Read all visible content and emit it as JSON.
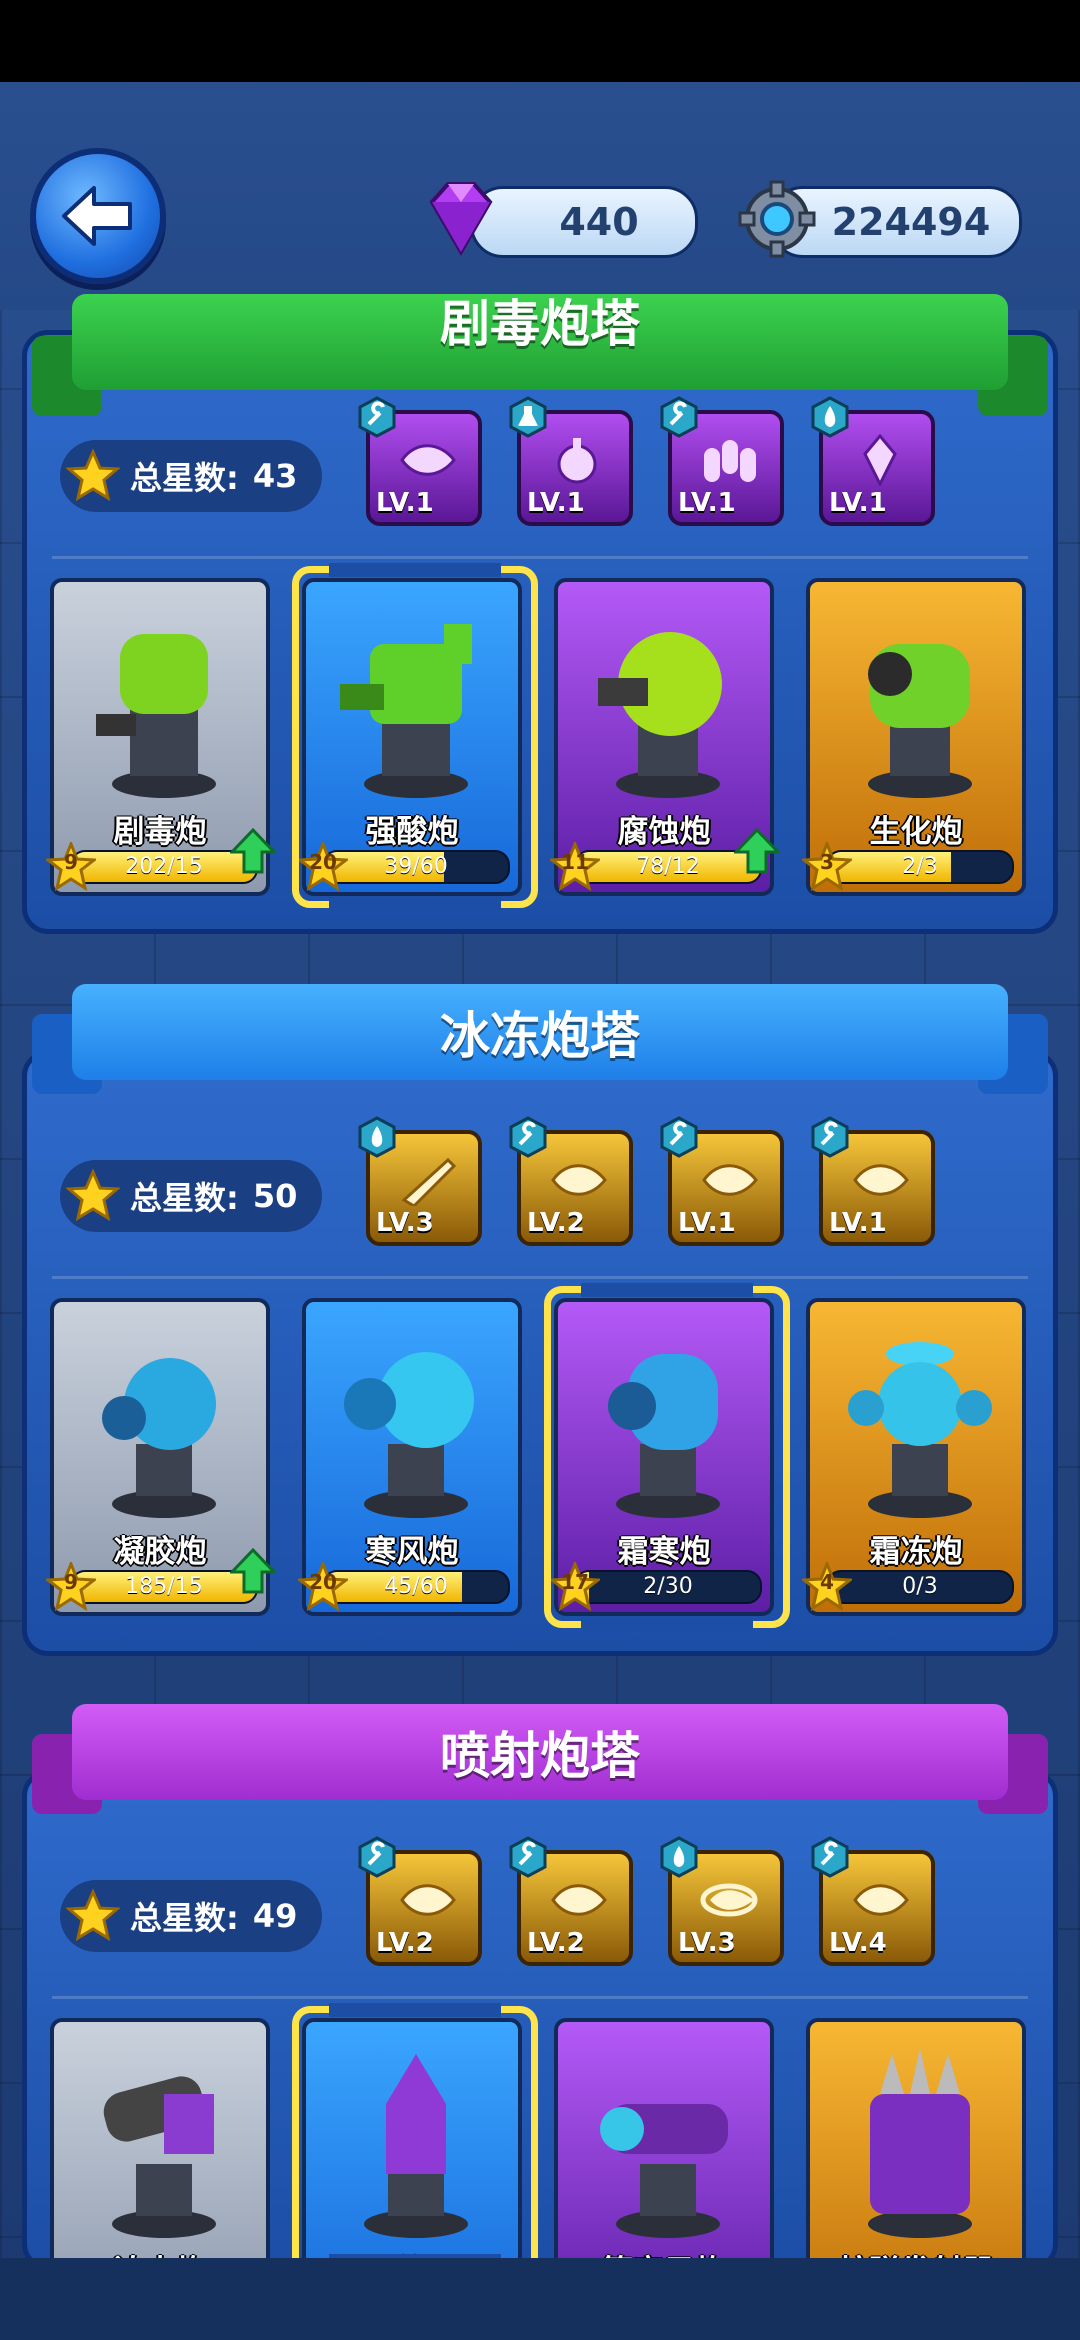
{
  "header": {
    "back_icon": "back-arrow-icon",
    "gems": {
      "icon": "gem-icon",
      "value": "440"
    },
    "gears": {
      "icon": "gear-icon",
      "value": "224494"
    }
  },
  "sections": [
    {
      "title": "剧毒炮塔",
      "color": "#2bb540",
      "star_label": "总星数:",
      "star_total": "43",
      "skills": [
        {
          "level": "LV.1",
          "style": "purple",
          "icon": "bullet-icon",
          "tag_icon": "wrench-icon"
        },
        {
          "level": "LV.1",
          "style": "purple",
          "icon": "bomb-icon",
          "tag_icon": "flask-icon"
        },
        {
          "level": "LV.1",
          "style": "purple",
          "icon": "shells-icon",
          "tag_icon": "wrench-icon"
        },
        {
          "level": "LV.1",
          "style": "purple",
          "icon": "crystal-icon",
          "tag_icon": "drop-icon"
        }
      ],
      "towers": [
        {
          "name": "剧毒炮",
          "stars": "9",
          "progress": "202/15",
          "fill": 1.0,
          "style": "gray",
          "upgrade": true
        },
        {
          "name": "强酸炮",
          "stars": "20",
          "progress": "39/60",
          "fill": 0.65,
          "style": "blue",
          "upgrade": false,
          "selected": true
        },
        {
          "name": "腐蚀炮",
          "stars": "11",
          "progress": "78/12",
          "fill": 1.0,
          "style": "purple",
          "upgrade": true
        },
        {
          "name": "生化炮",
          "stars": "3",
          "progress": "2/3",
          "fill": 0.67,
          "style": "gold",
          "upgrade": false
        }
      ]
    },
    {
      "title": "冰冻炮塔",
      "color": "#2f8ff0",
      "star_label": "总星数:",
      "star_total": "50",
      "skills": [
        {
          "level": "LV.3",
          "style": "gold",
          "icon": "rocket-icon",
          "tag_icon": "drop-icon"
        },
        {
          "level": "LV.2",
          "style": "gold",
          "icon": "bullet-icon",
          "tag_icon": "wrench-icon"
        },
        {
          "level": "LV.1",
          "style": "gold",
          "icon": "bullet-icon",
          "tag_icon": "wrench-icon"
        },
        {
          "level": "LV.1",
          "style": "gold",
          "icon": "bullet-icon",
          "tag_icon": "wrench-icon"
        }
      ],
      "towers": [
        {
          "name": "凝胶炮",
          "stars": "9",
          "progress": "185/15",
          "fill": 1.0,
          "style": "gray",
          "upgrade": true
        },
        {
          "name": "寒风炮",
          "stars": "20",
          "progress": "45/60",
          "fill": 0.75,
          "style": "blue",
          "upgrade": false
        },
        {
          "name": "霜寒炮",
          "stars": "17",
          "progress": "2/30",
          "fill": 0.07,
          "style": "purple",
          "upgrade": false,
          "selected": true
        },
        {
          "name": "霜冻炮",
          "stars": "4",
          "progress": "0/3",
          "fill": 0.0,
          "style": "gold",
          "upgrade": false
        }
      ]
    },
    {
      "title": "喷射炮塔",
      "color": "#b43fdc",
      "star_label": "总星数:",
      "star_total": "49",
      "skills": [
        {
          "level": "LV.2",
          "style": "gold",
          "icon": "bullet-icon",
          "tag_icon": "wrench-icon"
        },
        {
          "level": "LV.2",
          "style": "gold",
          "icon": "bullet-icon",
          "tag_icon": "wrench-icon"
        },
        {
          "level": "LV.3",
          "style": "gold",
          "icon": "spin-bullet-icon",
          "tag_icon": "drop-icon"
        },
        {
          "level": "LV.4",
          "style": "gold",
          "icon": "bullet-icon",
          "tag_icon": "wrench-icon"
        }
      ],
      "towers": [
        {
          "name": "迫击炮",
          "style": "gray"
        },
        {
          "name": "火箭炮",
          "style": "blue",
          "selected": true
        },
        {
          "name": "等离子炮",
          "style": "purple"
        },
        {
          "name": "核弹发射器",
          "style": "gold"
        }
      ]
    }
  ]
}
